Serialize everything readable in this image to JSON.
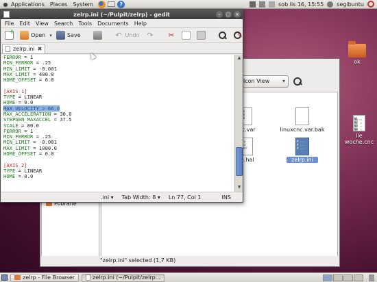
{
  "top_panel": {
    "menus": [
      "Applications",
      "Places",
      "System"
    ],
    "clock": "sob lis 16, 15:55",
    "user": "segibuntu"
  },
  "desktop": {
    "folder_label": "ok",
    "file_label": "lle woche.cnc",
    "file_preview": "N1 ..\nN2 ..\nN3 ..\nN4 .."
  },
  "file_browser": {
    "view_select": "Icon View",
    "files": [
      {
        "label": "cnc.var",
        "preview": "516\n518\n530"
      },
      {
        "label": "linuxcnc.var.bak",
        "preview": ""
      },
      {
        "label": "zelrp.ini",
        "preview": "# ...\n# ...\n# ..."
      },
      {
        "label": "rp.hal",
        "preview": "#ty\nloa\naddr"
      }
    ],
    "side_item": "Pobrane",
    "status": "\"zelrp.ini\" selected (1,7 KB)"
  },
  "gedit": {
    "title": "zelrp.ini (~/Pulpit/zelrp) - gedit",
    "menus": [
      "File",
      "Edit",
      "View",
      "Search",
      "Tools",
      "Documents",
      "Help"
    ],
    "toolbar": {
      "open": "Open",
      "save": "Save",
      "undo": "Undo"
    },
    "tab_label": "zelrp.ini",
    "lines": [
      {
        "key": "FERROR",
        "val": " = 1"
      },
      {
        "key": "MIN_FERROR",
        "val": " = .25"
      },
      {
        "key": "MIN_LIMIT",
        "val": " = -0.001"
      },
      {
        "key": "MAX_LIMIT",
        "val": " = 400.0"
      },
      {
        "key": "HOME_OFFSET",
        "val": " = 0.0"
      },
      {
        "key": "",
        "val": ""
      },
      {
        "section": "[AXIS_1]"
      },
      {
        "key": "TYPE",
        "val": " = LINEAR"
      },
      {
        "key": "HOME",
        "val": " = 0.0"
      },
      {
        "key": "MAX_VELOCITY",
        "val": " = 66.0",
        "selected": true
      },
      {
        "key": "MAX_ACCELERATION",
        "val": " = 30.0"
      },
      {
        "key": "STEPGEN_MAXACCEL",
        "val": " = 37.5"
      },
      {
        "key": "SCALE",
        "val": " = 80.0"
      },
      {
        "key": "FERROR",
        "val": " = 1"
      },
      {
        "key": "MIN_FERROR",
        "val": " = .25"
      },
      {
        "key": "MIN_LIMIT",
        "val": " = -0.001"
      },
      {
        "key": "MAX_LIMIT",
        "val": " = 1000.0"
      },
      {
        "key": "HOME_OFFSET",
        "val": " = 0.0"
      },
      {
        "key": "",
        "val": ""
      },
      {
        "section": "[AXIS_2]"
      },
      {
        "key": "TYPE",
        "val": " = LINEAR"
      },
      {
        "key": "HOME",
        "val": " = 0.0"
      }
    ],
    "status": {
      "lang": ".ini",
      "tab_width": "Tab Width:  8",
      "position": "Ln 77, Col 1",
      "mode": "INS"
    }
  },
  "bottom_panel": {
    "tasks": [
      "zelrp - File Browser",
      "zelrp.ini (~/Pulpit/zelrp..."
    ]
  },
  "colors": {
    "key": "#1a7a1a",
    "section": "#c81e1e",
    "selection": "#8bb0de",
    "titlebar": "#3c3b39"
  }
}
